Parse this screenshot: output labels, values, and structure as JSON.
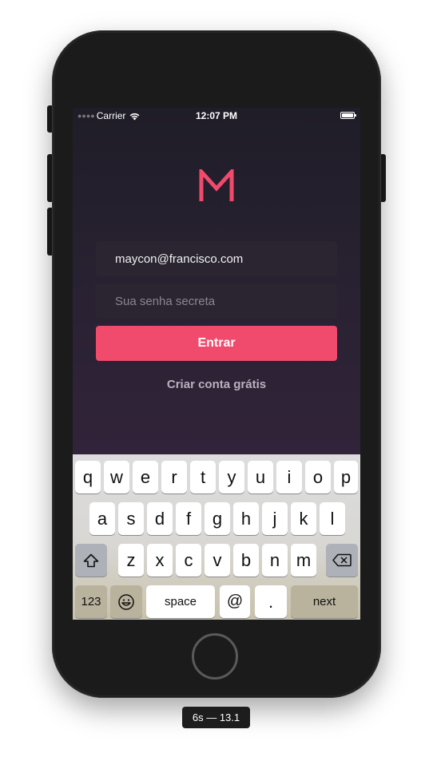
{
  "status_bar": {
    "carrier": "Carrier",
    "time": "12:07 PM"
  },
  "login": {
    "logo_letter": "M",
    "email_value": "maycon@francisco.com",
    "password_placeholder": "Sua senha secreta",
    "submit_label": "Entrar",
    "create_account_label": "Criar conta grátis"
  },
  "keyboard": {
    "row1": [
      "q",
      "w",
      "e",
      "r",
      "t",
      "y",
      "u",
      "i",
      "o",
      "p"
    ],
    "row2": [
      "a",
      "s",
      "d",
      "f",
      "g",
      "h",
      "j",
      "k",
      "l"
    ],
    "row3": [
      "z",
      "x",
      "c",
      "v",
      "b",
      "n",
      "m"
    ],
    "numbers_label": "123",
    "space_label": "space",
    "at_label": "@",
    "dot_label": ".",
    "next_label": "next"
  },
  "device_label": "6s — 13.1",
  "colors": {
    "accent": "#f04a6c",
    "background_top": "#1f1d28",
    "background_bottom": "#3a2541"
  }
}
